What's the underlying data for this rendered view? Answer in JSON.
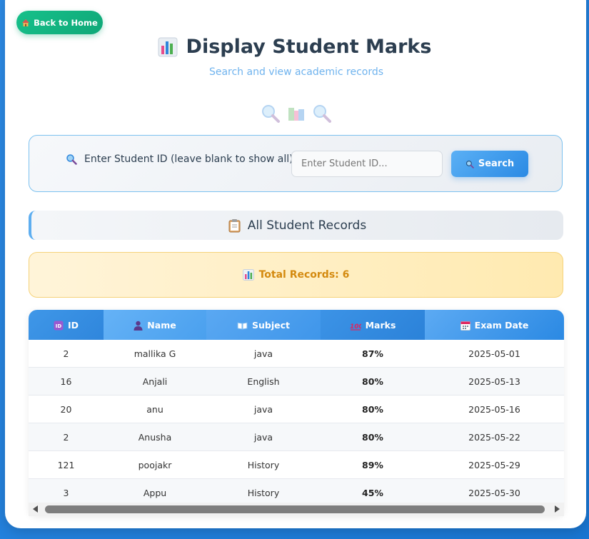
{
  "back_button": {
    "label": "Back to Home",
    "icon": "house-icon"
  },
  "header": {
    "title": "Display Student Marks",
    "title_icon": "bar-chart-icon",
    "subtitle": "Search and view academic records",
    "decor_icons": [
      "magnifier-icon",
      "books-icon",
      "magnifier-icon"
    ]
  },
  "search": {
    "label": "Enter Student ID (leave blank to show all):",
    "label_icon": "magnifier-icon",
    "placeholder": "Enter Student ID...",
    "value": "",
    "button_label": "Search",
    "button_icon": "magnifier-icon"
  },
  "records_header": {
    "label": "All Student Records",
    "icon": "clipboard-icon"
  },
  "total": {
    "label": "Total Records: 6",
    "icon": "bar-chart-icon"
  },
  "table": {
    "columns": [
      {
        "label": "ID",
        "icon": "id-badge-icon"
      },
      {
        "label": "Name",
        "icon": "person-icon"
      },
      {
        "label": "Subject",
        "icon": "open-book-icon"
      },
      {
        "label": "Marks",
        "icon": "hundred-points-icon"
      },
      {
        "label": "Exam Date",
        "icon": "calendar-icon"
      }
    ],
    "rows": [
      {
        "id": "2",
        "name": "mallika G",
        "subject": "java",
        "marks": "87%",
        "date": "2025-05-01"
      },
      {
        "id": "16",
        "name": "Anjali",
        "subject": "English",
        "marks": "80%",
        "date": "2025-05-13"
      },
      {
        "id": "20",
        "name": "anu",
        "subject": "java",
        "marks": "80%",
        "date": "2025-05-16"
      },
      {
        "id": "2",
        "name": "Anusha",
        "subject": "java",
        "marks": "80%",
        "date": "2025-05-22"
      },
      {
        "id": "121",
        "name": "poojakr",
        "subject": "History",
        "marks": "89%",
        "date": "2025-05-29"
      },
      {
        "id": "3",
        "name": "Appu",
        "subject": "History",
        "marks": "45%",
        "date": "2025-05-30"
      }
    ]
  },
  "colors": {
    "background": "#1976d2",
    "accent": "#2a8ae4",
    "back_button": "#10a878",
    "total_text": "#d48a0f"
  }
}
